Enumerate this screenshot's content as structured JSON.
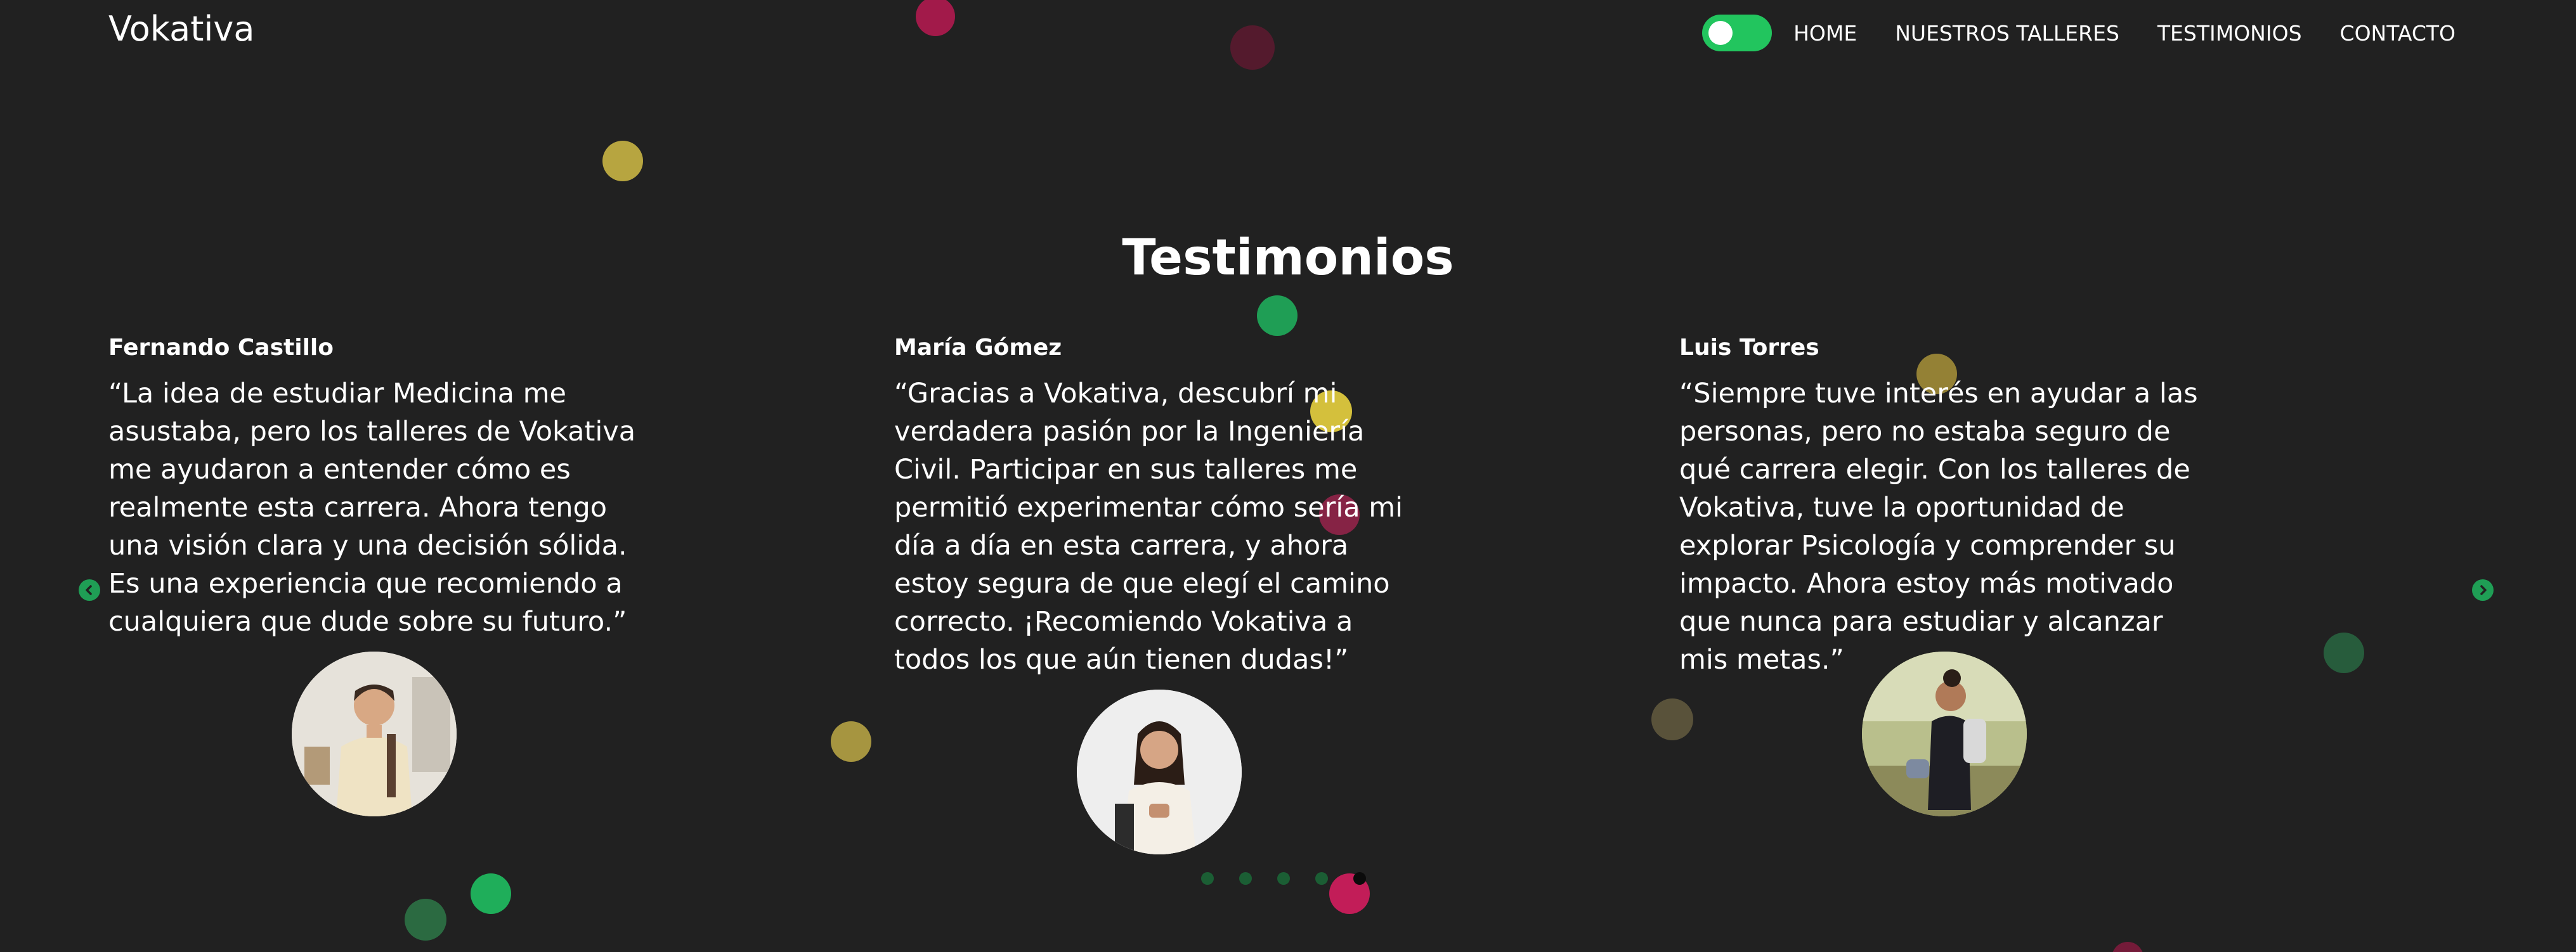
{
  "header": {
    "brand": "Vokativa",
    "theme_toggle": {
      "on": true
    },
    "nav": [
      {
        "label": "HOME"
      },
      {
        "label": "NUESTROS TALLERES"
      },
      {
        "label": "TESTIMONIOS"
      },
      {
        "label": "CONTACTO"
      }
    ]
  },
  "section": {
    "title": "Testimonios"
  },
  "testimonials": [
    {
      "name": "Fernando Castillo",
      "quote": "“La idea de estudiar Medicina me asustaba, pero los talleres de Vokativa me ayudaron a entender cómo es realmente esta carrera. Ahora tengo una visión clara y una decisión sólida. Es una experiencia que recomiendo a cualquiera que dude sobre su futuro.”"
    },
    {
      "name": "María Gómez",
      "quote": "“Gracias a Vokativa, descubrí mi verdadera pasión por la Ingeniería Civil. Participar en sus talleres me permitió experimentar cómo sería mi día a día en esta carrera, y ahora estoy segura de que elegí el camino correcto. ¡Recomiendo Vokativa a todos los que aún tienen dudas!”"
    },
    {
      "name": "Luis Torres",
      "quote": "“Siempre tuve interés en ayudar a las personas, pero no estaba seguro de qué carrera elegir. Con los talleres de Vokativa, tuve la oportunidad de explorar Psicología y comprender su impacto. Ahora estoy más motivado que nunca para estudiar y alcanzar mis metas.”"
    }
  ],
  "carousel": {
    "prev_icon": "chevron-left-icon",
    "next_icon": "chevron-right-icon",
    "dot_count": 5,
    "active_dot": 5
  },
  "colors": {
    "background": "#212121",
    "accent_green": "#22c55e",
    "bubble_yellow": "#c9b53a",
    "bubble_pink": "#c2185b",
    "bubble_green": "#2e7d4a"
  }
}
